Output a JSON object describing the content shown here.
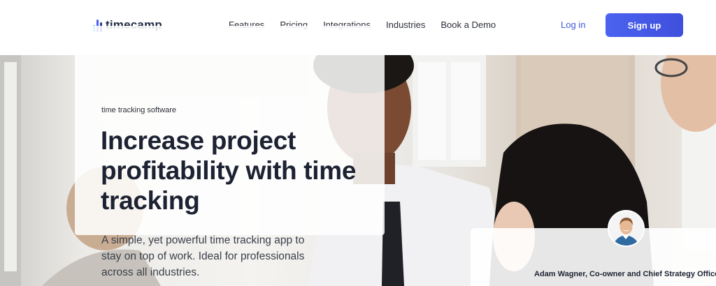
{
  "brand": {
    "name": "timecamp",
    "logo_colors": [
      "#3fb7f2",
      "#4a63f0",
      "#2f3a8f"
    ]
  },
  "nav": {
    "items": [
      {
        "label": "Features"
      },
      {
        "label": "Pricing"
      },
      {
        "label": "Integrations"
      },
      {
        "label": "Industries"
      },
      {
        "label": "Book a Demo"
      }
    ],
    "login_label": "Log in",
    "signup_label": "Sign up"
  },
  "hero": {
    "eyebrow": "time tracking software",
    "headline": "Increase project profitability with time tracking",
    "subtext": "A simple, yet powerful time tracking app to stay on top of work. Ideal for professionals across all industries."
  },
  "testimonial": {
    "attribution": "Adam Wagner, Co-owner and Chief Strategy Officer"
  },
  "colors": {
    "accent": "#4a63f0",
    "link": "#3f57d6",
    "heading": "#1d2233"
  }
}
